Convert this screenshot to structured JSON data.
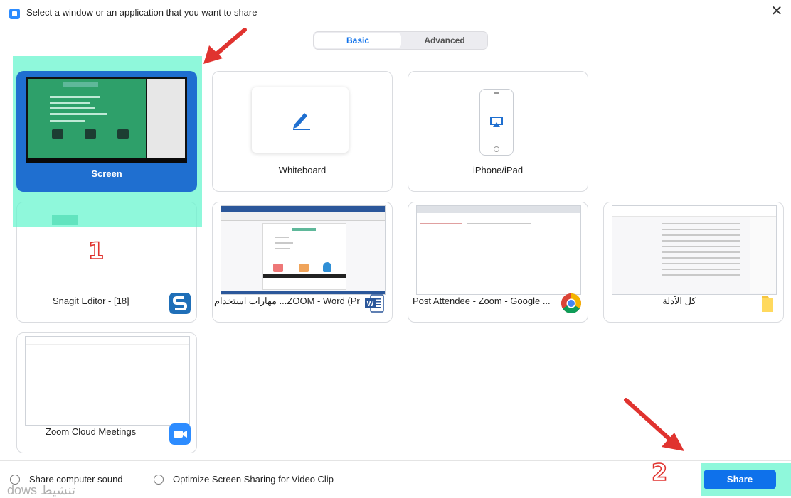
{
  "window": {
    "title": "Select a window or an application that you want to share",
    "close_glyph": "✕"
  },
  "tabs": {
    "basic": "Basic",
    "advanced": "Advanced"
  },
  "cards": {
    "screen": "Screen",
    "whiteboard": "Whiteboard",
    "iphone": "iPhone/iPad",
    "snagit": "Snagit Editor - [18]",
    "word": "ZOOM - Word (Pr... مهارات استخدام",
    "chrome": "Post Attendee - Zoom - Google ...",
    "explorer": "كل الأدلة",
    "zoom": "Zoom Cloud Meetings"
  },
  "options": {
    "share_sound": "Share computer sound",
    "optimize_video": "Optimize Screen Sharing for Video Clip"
  },
  "share_button": "Share",
  "annotations": {
    "step1": "1",
    "step2": "2"
  },
  "watermark": "dows تنشيط",
  "colors": {
    "accent": "#0e71eb",
    "highlight": "#5ef2cf",
    "arrow": "#e0332f"
  },
  "icons": {
    "pen": "pen-icon",
    "airplay": "airplay-icon",
    "snagit": "snagit-icon",
    "word": "word-icon",
    "chrome": "chrome-icon",
    "folder": "folder-icon",
    "zoom": "zoom-camera-icon"
  }
}
